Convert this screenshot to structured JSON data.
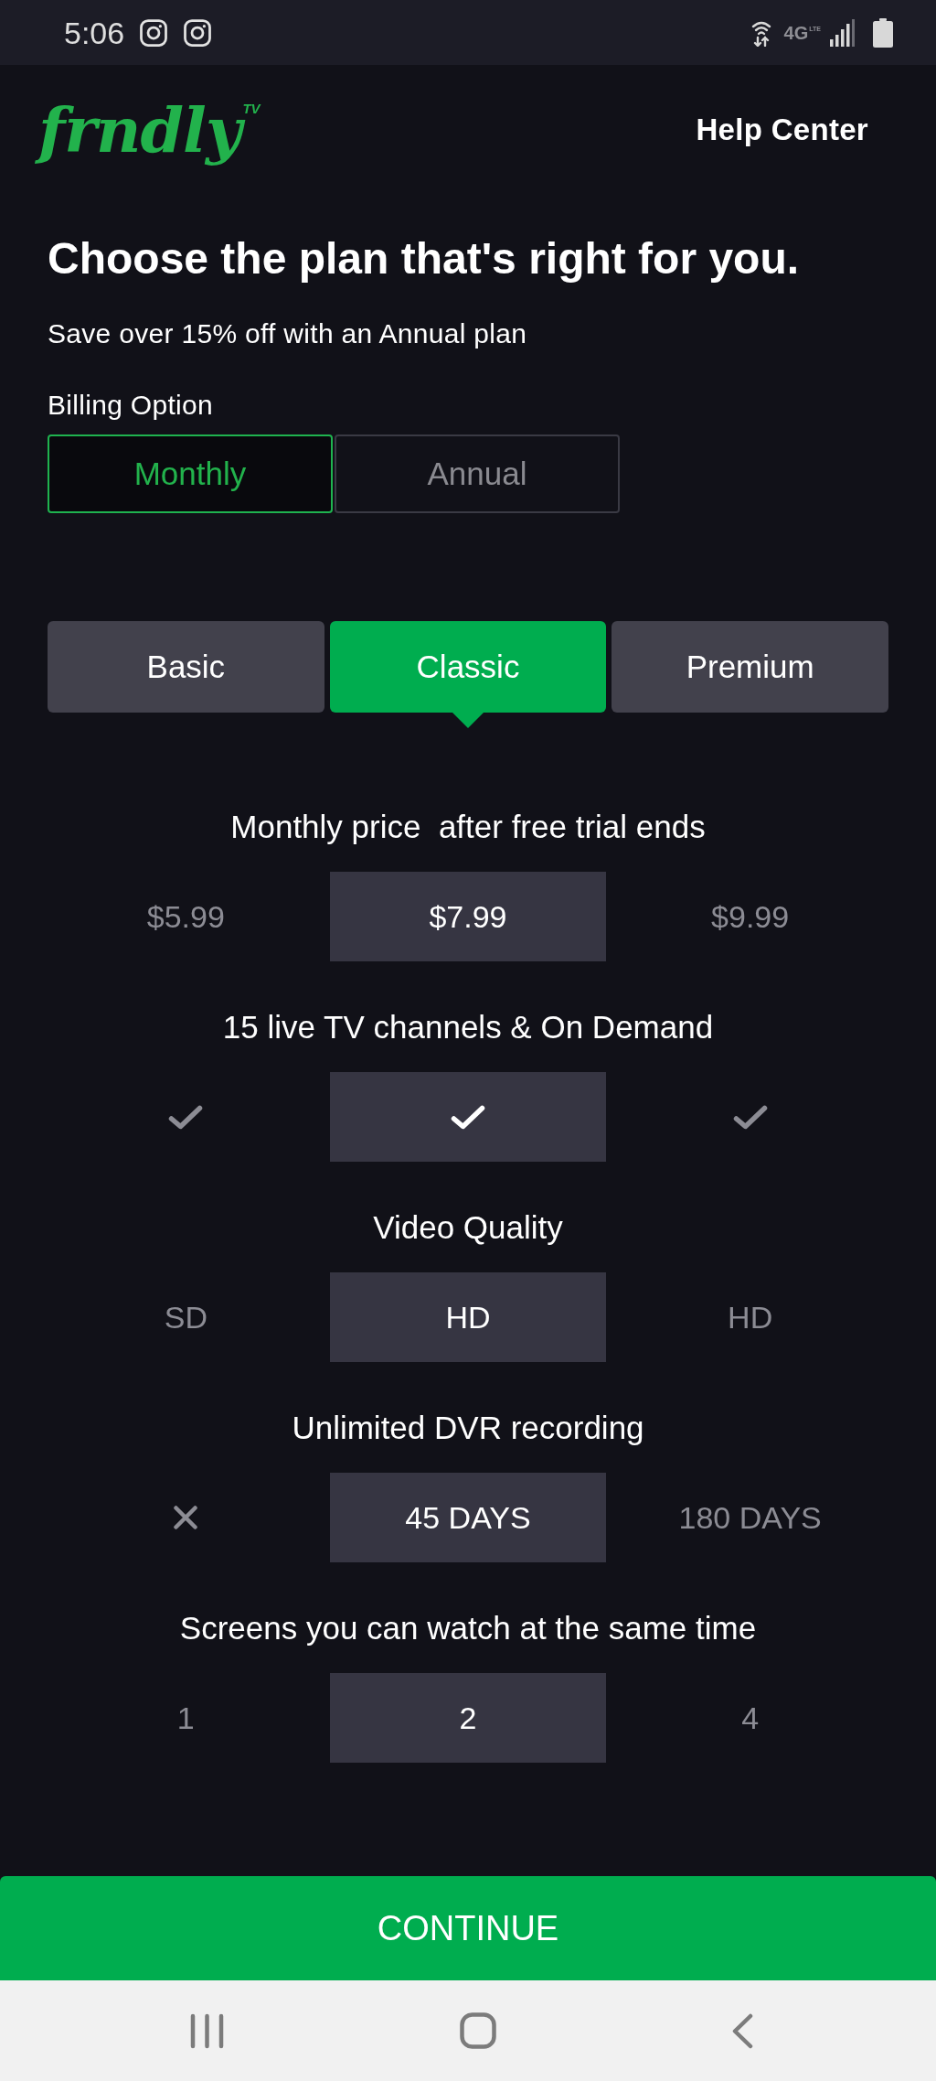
{
  "status_bar": {
    "time": "5:06",
    "network": "4G",
    "network_sub": "LTE"
  },
  "header": {
    "logo": "frndly",
    "logo_badge": "TV",
    "help_link": "Help Center"
  },
  "title": "Choose the plan that's right for you.",
  "subtitle": "Save over 15% off with an Annual plan",
  "billing": {
    "label": "Billing Option",
    "options": [
      {
        "label": "Monthly",
        "selected": true
      },
      {
        "label": "Annual",
        "selected": false
      }
    ]
  },
  "plans": [
    {
      "label": "Basic",
      "selected": false
    },
    {
      "label": "Classic",
      "selected": true
    },
    {
      "label": "Premium",
      "selected": false
    }
  ],
  "features": [
    {
      "title": "Monthly price  after free trial ends",
      "cells": [
        {
          "kind": "text",
          "text": "$5.99"
        },
        {
          "kind": "text",
          "text": "$7.99"
        },
        {
          "kind": "text",
          "text": "$9.99"
        }
      ]
    },
    {
      "title": "15 live TV channels & On Demand",
      "cells": [
        {
          "kind": "check"
        },
        {
          "kind": "check"
        },
        {
          "kind": "check"
        }
      ]
    },
    {
      "title": "Video Quality",
      "cells": [
        {
          "kind": "text",
          "text": "SD"
        },
        {
          "kind": "text",
          "text": "HD"
        },
        {
          "kind": "text",
          "text": "HD"
        }
      ]
    },
    {
      "title": "Unlimited DVR recording",
      "cells": [
        {
          "kind": "cross"
        },
        {
          "kind": "text",
          "text": "45 DAYS"
        },
        {
          "kind": "text",
          "text": "180 DAYS"
        }
      ]
    },
    {
      "title": "Screens you can watch at the same time",
      "cells": [
        {
          "kind": "text",
          "text": "1"
        },
        {
          "kind": "text",
          "text": "2"
        },
        {
          "kind": "text",
          "text": "4"
        }
      ]
    }
  ],
  "continue_button": "CONTINUE"
}
